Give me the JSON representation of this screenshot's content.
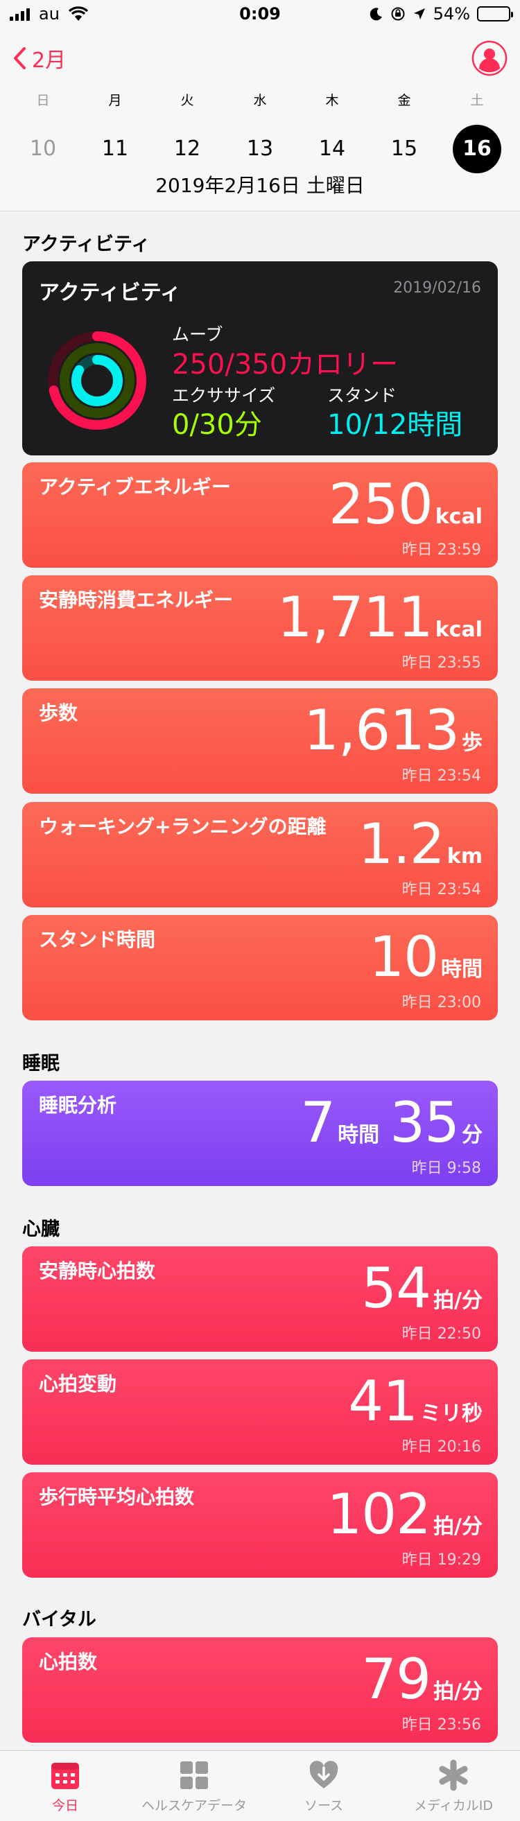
{
  "status_bar": {
    "carrier": "au",
    "time": "0:09",
    "battery": "54%",
    "battery_level": 0.54
  },
  "header": {
    "back_label": "2月",
    "weekdays": [
      "日",
      "月",
      "火",
      "水",
      "木",
      "金",
      "土"
    ],
    "dates": [
      "10",
      "11",
      "12",
      "13",
      "14",
      "15",
      "16"
    ],
    "selected_index": 6,
    "full_date": "2019年2月16日 土曜日"
  },
  "sections": {
    "activity": "アクティビティ",
    "sleep": "睡眠",
    "heart": "心臓",
    "vitals": "バイタル"
  },
  "activity_card": {
    "title": "アクティビティ",
    "date": "2019/02/16",
    "move_label": "ムーブ",
    "move_value": "250/350カロリー",
    "exercise_label": "エクササイズ",
    "exercise_value": "0/30分",
    "stand_label": "スタンド",
    "stand_value": "10/12時間",
    "move_progress": 0.714,
    "exercise_progress": 0.0,
    "stand_progress": 0.833,
    "colors": {
      "move": "#fa114f",
      "exercise": "#a6ff00",
      "stand": "#00f0f0"
    }
  },
  "metrics": {
    "active_energy": {
      "label": "アクティブエネルギー",
      "value": "250",
      "unit": "kcal",
      "time": "昨日 23:59"
    },
    "resting_energy": {
      "label": "安静時消費エネルギー",
      "value": "1,711",
      "unit": "kcal",
      "time": "昨日 23:55"
    },
    "steps": {
      "label": "歩数",
      "value": "1,613",
      "unit": "歩",
      "time": "昨日 23:54"
    },
    "walk_run_distance": {
      "label": "ウォーキング+ランニングの距離",
      "value": "1.2",
      "unit": "km",
      "time": "昨日 23:54"
    },
    "stand_hours": {
      "label": "スタンド時間",
      "value": "10",
      "unit": "時間",
      "time": "昨日 23:00"
    },
    "sleep_analysis": {
      "label": "睡眠分析",
      "value1": "7",
      "unit1": "時間",
      "value2": "35",
      "unit2": "分",
      "time": "昨日 9:58"
    },
    "resting_hr": {
      "label": "安静時心拍数",
      "value": "54",
      "unit": "拍/分",
      "time": "昨日 22:50"
    },
    "hrv": {
      "label": "心拍変動",
      "value": "41",
      "unit": "ミリ秒",
      "time": "昨日 20:16"
    },
    "walking_hr": {
      "label": "歩行時平均心拍数",
      "value": "102",
      "unit": "拍/分",
      "time": "昨日 19:29"
    },
    "heart_rate": {
      "label": "心拍数",
      "value": "79",
      "unit": "拍/分",
      "time": "昨日 23:56"
    }
  },
  "tabbar": {
    "today": "今日",
    "health_data": "ヘルスケアデータ",
    "sources": "ソース",
    "medical_id": "メディカルID"
  },
  "colors": {
    "accent": "#ff2d55",
    "energy": "#fb5a4c",
    "sleep": "#8a4cf6",
    "heart": "#fb3a5e"
  }
}
